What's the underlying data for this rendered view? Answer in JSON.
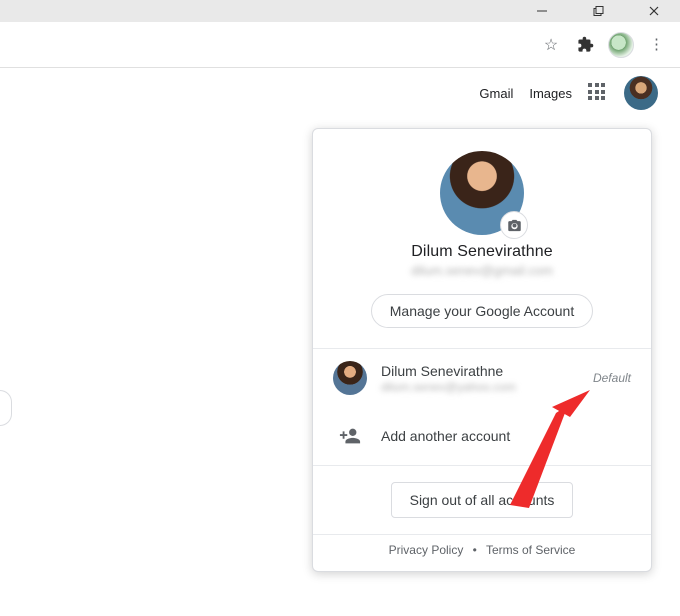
{
  "header": {
    "gmail": "Gmail",
    "images": "Images"
  },
  "popup": {
    "name": "Dilum Senevirathne",
    "email_obscured": "dilum.senev@gmail.com",
    "manage": "Manage your Google Account",
    "accounts": [
      {
        "name": "Dilum Senevirathne",
        "email_obscured": "dilum.senev@yahoo.com",
        "badge": "Default"
      }
    ],
    "add_account": "Add another account",
    "signout": "Sign out of all accounts",
    "privacy": "Privacy Policy",
    "terms": "Terms of Service"
  }
}
